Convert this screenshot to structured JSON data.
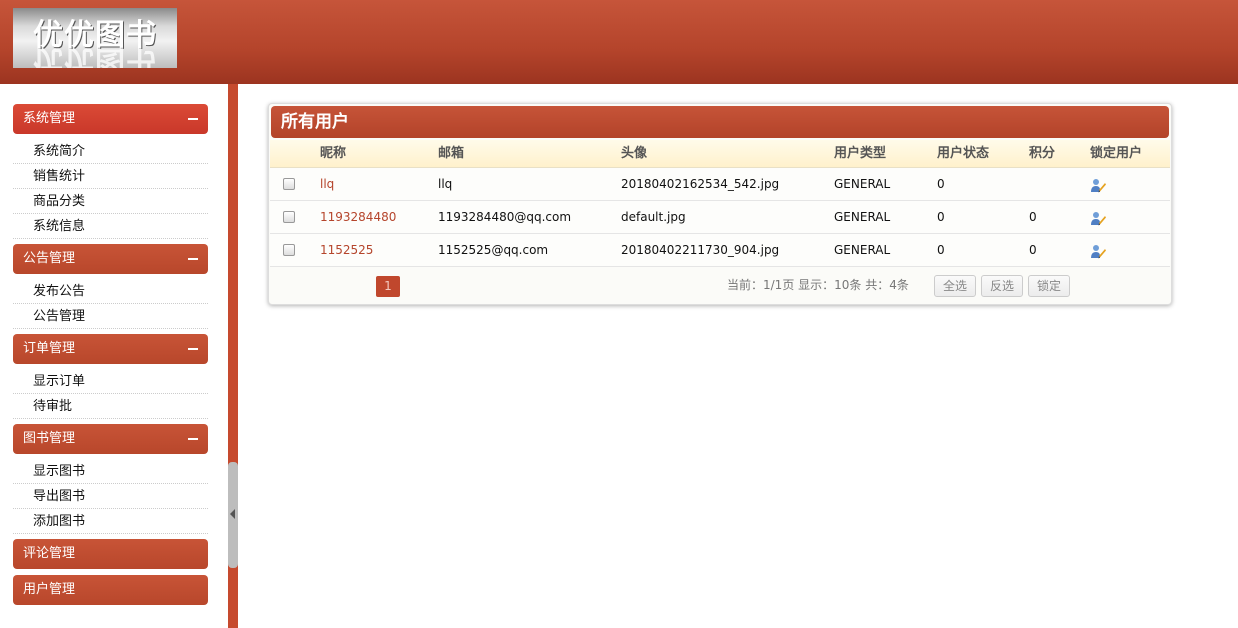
{
  "header": {
    "logo_text": "优优图书"
  },
  "sidebar": {
    "groups": [
      {
        "title": "系统管理",
        "items": [
          "系统简介",
          "销售统计",
          "商品分类",
          "系统信息"
        ]
      },
      {
        "title": "公告管理",
        "items": [
          "发布公告",
          "公告管理"
        ]
      },
      {
        "title": "订单管理",
        "items": [
          "显示订单",
          "待审批"
        ]
      },
      {
        "title": "图书管理",
        "items": [
          "显示图书",
          "导出图书",
          "添加图书"
        ]
      },
      {
        "title": "评论管理",
        "items": []
      },
      {
        "title": "用户管理",
        "items": []
      }
    ]
  },
  "panel": {
    "title": "所有用户",
    "columns": [
      "昵称",
      "邮箱",
      "头像",
      "用户类型",
      "用户状态",
      "积分",
      "锁定用户"
    ],
    "rows": [
      {
        "nickname": "llq",
        "email": "llq",
        "avatar": "20180402162534_542.jpg",
        "type": "GENERAL",
        "status": "0",
        "points": ""
      },
      {
        "nickname": "1193284480",
        "email": "1193284480@qq.com",
        "avatar": "default.jpg",
        "type": "GENERAL",
        "status": "0",
        "points": "0"
      },
      {
        "nickname": "1152525",
        "email": "1152525@qq.com",
        "avatar": "20180402211730_904.jpg",
        "type": "GENERAL",
        "status": "0",
        "points": "0"
      }
    ],
    "pager": {
      "page": "1",
      "info": "当前：1/1页 显示：10条 共：4条"
    },
    "buttons": {
      "select_all": "全选",
      "invert": "反选",
      "lock": "锁定"
    }
  },
  "colors": {
    "brand": "#b8472b",
    "active_menu": "#d8432f"
  }
}
